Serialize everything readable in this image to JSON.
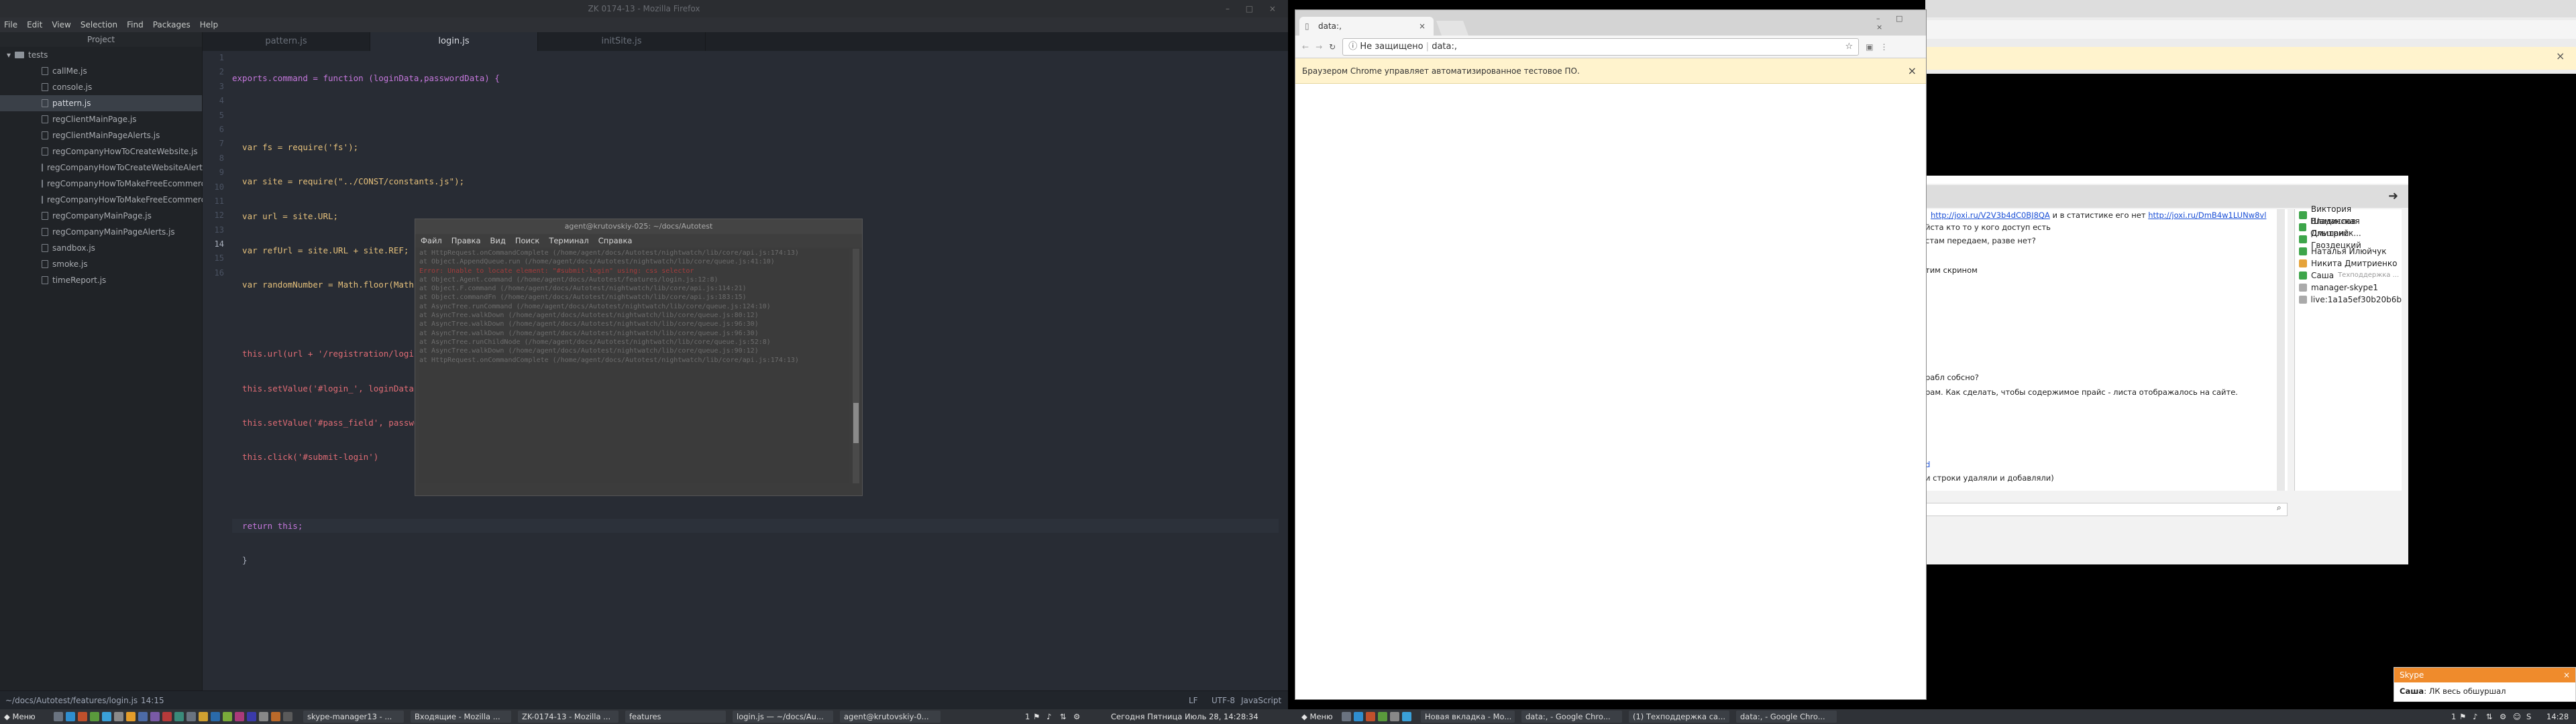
{
  "atom": {
    "window_title": "ZK 0174-13 - Mozilla Firefox",
    "menu": [
      "File",
      "Edit",
      "View",
      "Selection",
      "Find",
      "Packages",
      "Help"
    ],
    "project_title": "Project",
    "tree_root": "tests",
    "tree_items": [
      "callMe.js",
      "console.js",
      "pattern.js",
      "regClientMainPage.js",
      "regClientMainPageAlerts.js",
      "regCompanyHowToCreateWebsite.js",
      "regCompanyHowToCreateWebsiteAlerts.js",
      "regCompanyHowToMakeFreeEcommerce.js",
      "regCompanyHowToMakeFreeEcommerceAlerts.js",
      "regCompanyMainPage.js",
      "regCompanyMainPageAlerts.js",
      "sandbox.js",
      "smoke.js",
      "timeReport.js"
    ],
    "selected_item": "pattern.js",
    "tabs": [
      "pattern.js",
      "login.js",
      "initSite.js"
    ],
    "active_tab": "login.js",
    "line_numbers": [
      "1",
      "2",
      "3",
      "4",
      "5",
      "6",
      "7",
      "8",
      "9",
      "10",
      "11",
      "12",
      "13",
      "14",
      "15",
      "16"
    ],
    "code_lines": [
      "exports.command = function (loginData,passwordData) {",
      "",
      "  var fs = require('fs');",
      "  var site = require(\"../CONST/constants.js\");",
      "  var url = site.URL;",
      "  var refUrl = site.URL + site.REF;",
      "  var randomNumber = Math.floor(Math.random() * (100000 - 1 + 1)) + 1;",
      "",
      "  this.url(url + '/registration/login/')",
      "  this.setValue('#login_', loginData)",
      "  this.setValue('#pass_field', passwordData)",
      "  this.click('#submit-login')",
      "",
      "  return this;",
      "  }",
      ""
    ],
    "status_left": "~/docs/Autotest/features/login.js",
    "status_pos": "14:15",
    "status_right": [
      "LF",
      "UTF-8",
      "JavaScript"
    ]
  },
  "terminal": {
    "title": "agent@krutovskiy-025: ~/docs/Autotest",
    "menu": [
      "Файл",
      "Правка",
      "Вид",
      "Поиск",
      "Терминал",
      "Справка"
    ],
    "lines": [
      "    at HttpRequest.onCommandComplete (/home/agent/docs/Autotest/nightwatch/lib/core/api.js:174:13)",
      "    at Object.AppendQueue.run (/home/agent/docs/Autotest/nightwatch/lib/core/queue.js:41:10)",
      "Error: Unable to locate element: \"#submit-login\" using: css selector",
      "    at Object.Agent.command (/home/agent/docs/Autotest/features/login.js:12:8)",
      "    at Object.F.command (/home/agent/docs/Autotest/nightwatch/lib/core/api.js:114:21)",
      "    at Object.commandFn (/home/agent/docs/Autotest/nightwatch/lib/core/api.js:183:15)",
      "    at AsyncTree.runCommand (/home/agent/docs/Autotest/nightwatch/lib/core/queue.js:124:10)",
      "    at AsyncTree.walkDown (/home/agent/docs/Autotest/nightwatch/lib/core/queue.js:80:12)",
      "    at AsyncTree.walkDown (/home/agent/docs/Autotest/nightwatch/lib/core/queue.js:96:30)",
      "    at AsyncTree.walkDown (/home/agent/docs/Autotest/nightwatch/lib/core/queue.js:96:30)",
      "    at AsyncTree.runChildNode (/home/agent/docs/Autotest/nightwatch/lib/core/queue.js:52:8)",
      "    at AsyncTree.walkDown (/home/agent/docs/Autotest/nightwatch/lib/core/queue.js:90:12)",
      "    at HttpRequest.onCommandComplete (/home/agent/docs/Autotest/nightwatch/lib/core/api.js:174:13)"
    ]
  },
  "chrome": {
    "tab_title": "data:,",
    "not_secure": "Не защищено",
    "url": "data:,",
    "infobar": "Браузером Chrome управляет автоматизированное тестовое ПО."
  },
  "skype": {
    "contacts": [
      "Виктория Шаманская",
      "Владислав Ольшанск...",
      "Дмитрий Гвоздецкий",
      "Наталья Илюйчук",
      "Никита Дмитриенко",
      "Саша",
      "manager-skype1",
      "live:1a1a5ef30b20b6b"
    ],
    "contact_note": "Техподдержка ...",
    "links": [
      "http://joxi.ru/V2V3b4dC0BJ8QA",
      "http://joxi.ru/DmB4w1LUNw8vl"
    ],
    "msg1_mid": " и в статистике его нет ",
    "msg2": "йста кто то у кого доступ есть",
    "msg3": "стам передаем, разве нет?",
    "msg4": "тим скрином",
    "msg5": "рабл собсно?",
    "msg6": "рам. Как сделать, чтобы содержимое прайс - листа отображалось на сайте.",
    "msg7": "и строки удаляли и добавляли)",
    "msg8": "d"
  },
  "toast": {
    "app": "Skype",
    "sender": "Саша",
    "text": "ЛК весь обшуршал"
  },
  "taskbar": {
    "menu1": "Меню",
    "menu2": "Меню",
    "left_items": [
      "skype-manager13 - ...",
      "Входящие - Mozilla ...",
      "ZK-0174-13 - Mozilla ...",
      "features",
      "login.js — ~/docs/Au...",
      "agent@krutovskiy-0..."
    ],
    "right_items": [
      "Новая вкладка - Mo...",
      "data:, - Google Chro...",
      "(1) Техподдержка са...",
      "data:, - Google Chro..."
    ],
    "clock1": "Сегодня Пятница Июль 28, 14:28:34",
    "clock2": "14:28",
    "tray1": "1",
    "tray2": "1"
  }
}
